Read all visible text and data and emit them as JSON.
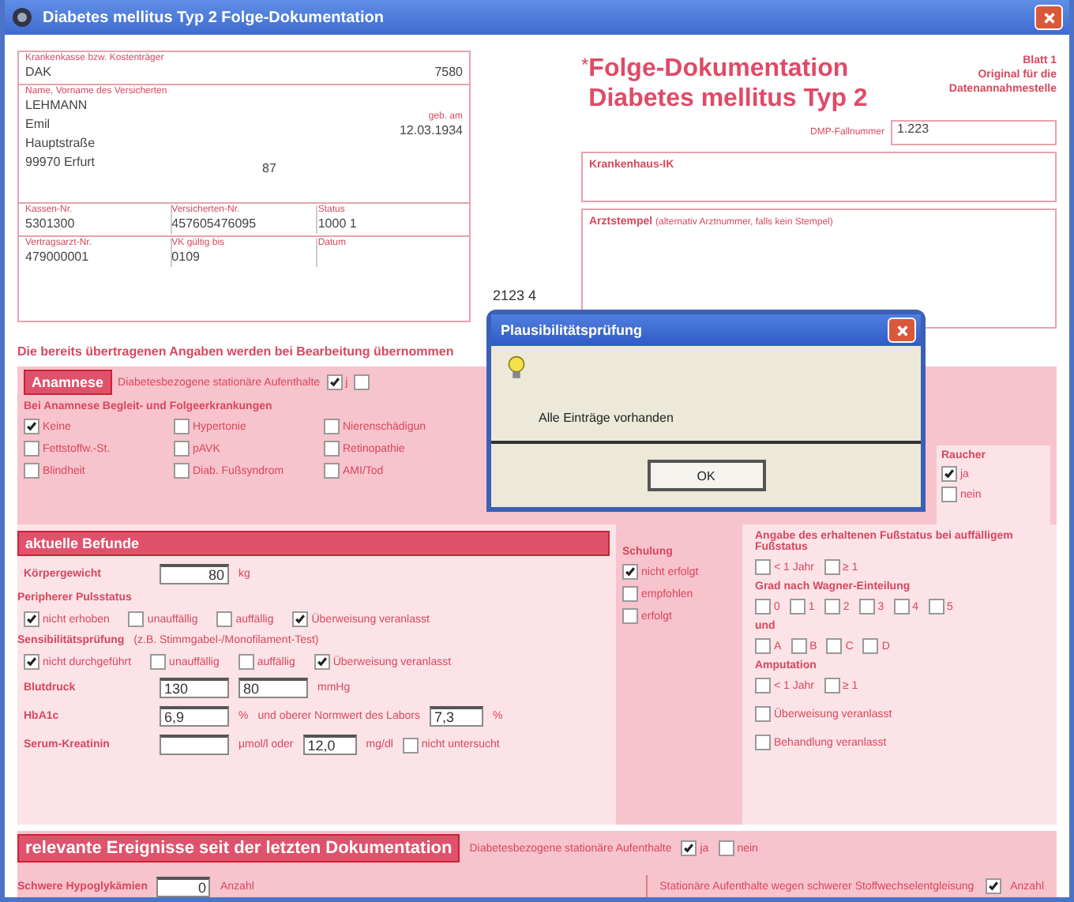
{
  "window": {
    "title": "Diabetes mellitus Typ 2 Folge-Dokumentation"
  },
  "patient_card": {
    "insurer": {
      "label": "Krankenkasse bzw. Kostenträger",
      "value": "DAK",
      "code": "7580"
    },
    "person": {
      "label": "Name, Vorname des Versicherten",
      "lines": [
        "LEHMANN",
        "Emil",
        "Hauptstraße",
        "99970   Erfurt"
      ],
      "house_no": "87",
      "birth_label": "geb. am",
      "birth_date": "12.03.1934"
    },
    "ids": [
      {
        "label": "Kassen-Nr.",
        "value": "5301300"
      },
      {
        "label": "Versicherten-Nr.",
        "value": "457605476095"
      },
      {
        "label": "Status",
        "value": "1000    1"
      }
    ],
    "ids2": [
      {
        "label": "Vertragsarzt-Nr.",
        "value": "479000001"
      },
      {
        "label": "VK gültig bis",
        "value": "0109"
      },
      {
        "label": "Datum"
      }
    ]
  },
  "header": {
    "title_mark": "*",
    "title_lines": [
      "Folge-Dokumentation",
      "Diabetes mellitus Typ 2"
    ],
    "sheet_lines": [
      "Blatt 1",
      "Original für die",
      "Datenannahmestelle"
    ],
    "case_number": {
      "label": "DMP-Fallnummer",
      "value": "1.223"
    },
    "hospital": {
      "label": "Krankenhaus-IK"
    },
    "stamp": {
      "label": "Arztstempel",
      "hint": "(alternativ Arztnummer, falls kein Stempel)"
    },
    "code_fragment": "2123 4"
  },
  "notice": "Die bereits übertragenen Angaben werden bei Bearbeitung übernommen",
  "anamnese": {
    "title": "Anamnese",
    "question": "Diabetesbezogene stationäre Aufenthalte",
    "answers": [
      {
        "label": "j",
        "checked": true
      },
      {
        "checked": false
      }
    ],
    "list_label": "Bei Anamnese Begleit- und Folgeerkrankungen",
    "items": [
      {
        "label": "Keine",
        "checked": true
      },
      {
        "label": "Hypertonie",
        "checked": false
      },
      {
        "label": "Nierenschädigun",
        "checked": false
      },
      {
        "label": "Fettstoffw.-St.",
        "checked": false
      },
      {
        "label": "pAVK",
        "checked": false
      },
      {
        "label": "Retinopathie",
        "checked": false
      },
      {
        "label": "Blindheit",
        "checked": false
      },
      {
        "label": "Diab. Fußsyndrom",
        "checked": false
      },
      {
        "label": "AMI/Tod",
        "checked": false
      }
    ]
  },
  "smoker": {
    "label": "Raucher",
    "options": [
      {
        "label": "ja",
        "checked": true
      },
      {
        "label": "nein",
        "checked": false
      }
    ]
  },
  "findings": {
    "title": "aktuelle Befunde",
    "weight": {
      "label": "Körpergewicht",
      "value": "80",
      "unit": "kg"
    },
    "pulse": {
      "label": "Peripherer Pulsstatus",
      "options": [
        {
          "label": "nicht erhoben",
          "checked": true
        },
        {
          "label": "unauffällig",
          "checked": false
        },
        {
          "label": "auffällig",
          "checked": false
        },
        {
          "label": "Überweisung veranlasst",
          "checked": true
        }
      ]
    },
    "sensibility": {
      "label": "Sensibilitätsprüfung",
      "hint": "(z.B. Stimmgabel-/Monofilament-Test)",
      "options": [
        {
          "label": "nicht durchgeführt",
          "checked": true
        },
        {
          "label": "unauffällig",
          "checked": false
        },
        {
          "label": "auffällig",
          "checked": false
        },
        {
          "label": "Überweisung veranlasst",
          "checked": true
        }
      ]
    },
    "blood_pressure": {
      "label": "Blutdruck",
      "systolic": "130",
      "diastolic": "80",
      "unit": "mmHg"
    },
    "hba1c": {
      "label": "HbA1c",
      "value": "6,9",
      "unit": "%",
      "ref_label": "und oberer Normwert des Labors",
      "ref_value": "7,3",
      "ref_unit": "%"
    },
    "creatinine": {
      "label": "Serum-Kreatinin",
      "unit": "µmol/l oder",
      "value": "12,0",
      "unit2": "mg/dl",
      "not_measured": {
        "label": "nicht untersucht",
        "checked": false
      }
    }
  },
  "training": {
    "title": "Schulung",
    "options": [
      {
        "label": "nicht erfolgt",
        "checked": true
      },
      {
        "label": "empfohlen",
        "checked": false
      },
      {
        "label": "erfolgt",
        "checked": false
      }
    ]
  },
  "foot": {
    "title": "Angabe des erhaltenen Fußstatus bei auffälligem Fußstatus",
    "groups": [
      {
        "options": [
          {
            "label": "< 1 Jahr",
            "checked": false
          },
          {
            "label": "≥ 1",
            "checked": false
          }
        ]
      },
      {
        "label": "Grad nach Wagner-Einteilung",
        "options": [
          {
            "label": "0",
            "checked": false
          },
          {
            "label": "1",
            "checked": false
          },
          {
            "label": "2",
            "checked": false
          },
          {
            "label": "3",
            "checked": false
          },
          {
            "label": "4",
            "checked": false
          },
          {
            "label": "5",
            "checked": false
          }
        ]
      },
      {
        "label": "und",
        "options": [
          {
            "label": "A",
            "checked": false
          },
          {
            "label": "B",
            "checked": false
          },
          {
            "label": "C",
            "checked": false
          },
          {
            "label": "D",
            "checked": false
          }
        ]
      },
      {
        "label": "Amputation",
        "options": [
          {
            "label": "< 1 Jahr",
            "checked": false
          },
          {
            "label": "≥ 1",
            "checked": false
          }
        ]
      }
    ],
    "actions": [
      {
        "label": "Überweisung veranlasst",
        "checked": false
      },
      {
        "label": "Behandlung veranlasst",
        "checked": false
      }
    ]
  },
  "events": {
    "title": "relevante Ereignisse seit der letzten Dokumentation",
    "inpatient": {
      "label": "Diabetesbezogene stationäre Aufenthalte",
      "options": [
        {
          "label": "ja",
          "checked": true
        },
        {
          "label": "nein",
          "checked": false
        }
      ]
    },
    "hypo": {
      "label": "Schwere Hypoglykämien",
      "value": "0",
      "unit": "Anzahl"
    },
    "derailment": {
      "label": "Stationäre Aufenthalte wegen schwerer Stoffwechselentgleisung",
      "checked": true,
      "unit": "Anzahl"
    }
  },
  "dialog": {
    "title": "Plausibilitätsprüfung",
    "message": "Alle Einträge vorhanden",
    "button": "OK"
  }
}
